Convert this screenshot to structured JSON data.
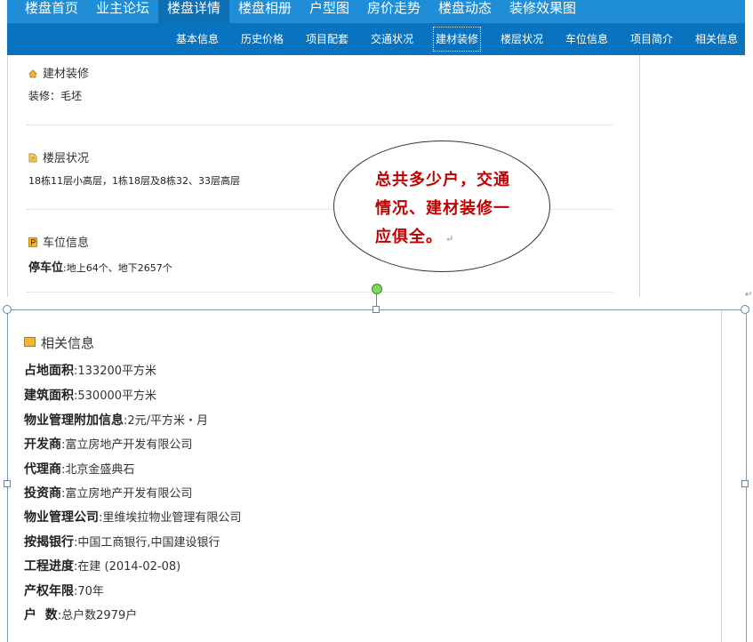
{
  "top_nav": [
    {
      "label": "楼盘首页",
      "active": false
    },
    {
      "label": "业主论坛",
      "active": false
    },
    {
      "label": "楼盘详情",
      "active": true
    },
    {
      "label": "楼盘相册",
      "active": false
    },
    {
      "label": "户型图",
      "active": false
    },
    {
      "label": "房价走势",
      "active": false
    },
    {
      "label": "楼盘动态",
      "active": false
    },
    {
      "label": "装修效果图",
      "active": false
    }
  ],
  "sub_nav": [
    {
      "label": "基本信息",
      "active": false
    },
    {
      "label": "历史价格",
      "active": false
    },
    {
      "label": "项目配套",
      "active": false
    },
    {
      "label": "交通状况",
      "active": false
    },
    {
      "label": "建材装修",
      "active": true
    },
    {
      "label": "楼层状况",
      "active": false
    },
    {
      "label": "车位信息",
      "active": false
    },
    {
      "label": "项目简介",
      "active": false
    },
    {
      "label": "相关信息",
      "active": false
    }
  ],
  "sections": {
    "decoration": {
      "title": "建材装修",
      "label": "装修：",
      "value": "毛坯"
    },
    "floors": {
      "title": "楼层状况",
      "text": "18栋11层小高层，1栋18层及8栋32、33层高层"
    },
    "parking": {
      "title": "车位信息",
      "label": "停车位",
      "value": ":地上64个、地下2657个"
    }
  },
  "callout": {
    "text": "总共多少户，交通情况、建材装修一应俱全。",
    "return_mark": "↵"
  },
  "return_mark": "↵",
  "related_info": {
    "title": "相关信息",
    "rows": [
      {
        "key": "占地面积",
        "value": ":133200平方米"
      },
      {
        "key": "建筑面积",
        "value": ":530000平方米"
      },
      {
        "key": "物业管理附加信息",
        "value": ":2元/平方米・月"
      },
      {
        "key": "开发商",
        "value": ":富立房地产开发有限公司"
      },
      {
        "key": "代理商",
        "value": ":北京金盛典石"
      },
      {
        "key": "投资商",
        "value": ":富立房地产开发有限公司"
      },
      {
        "key": "物业管理公司",
        "value": ":里维埃拉物业管理有限公司"
      },
      {
        "key": "按揭银行",
        "value": ":中国工商银行,中国建设银行"
      },
      {
        "key": "工程进度",
        "value": ":在建 (2014-02-08)"
      },
      {
        "key": "产权年限",
        "value": ":70年"
      },
      {
        "key": "户  数",
        "value": ":总户数2979户"
      }
    ]
  },
  "colors": {
    "nav_bg": "#1f8ed6",
    "subnav_bg": "#0a73bf",
    "callout_text": "#c00000"
  }
}
